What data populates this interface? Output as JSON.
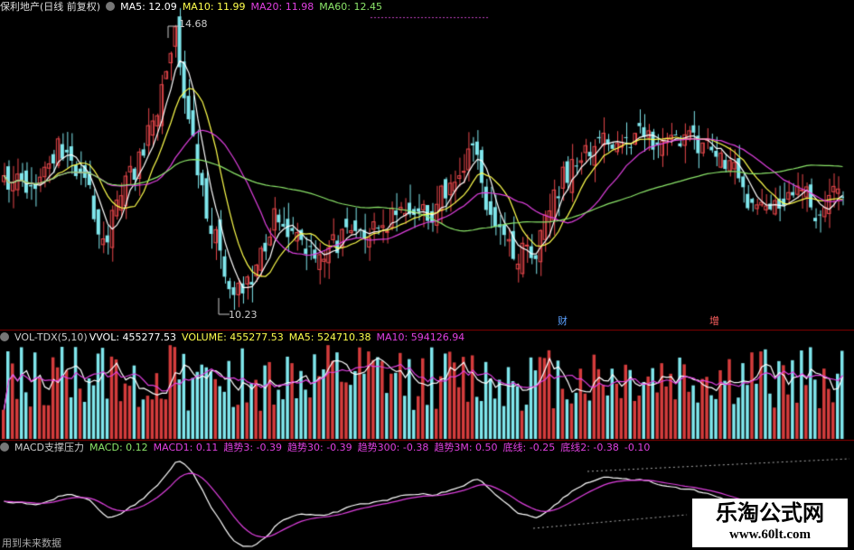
{
  "colors": {
    "up": "#e8474b",
    "up_vol": "#d43c3c",
    "down": "#7fe6ec",
    "white": "#ffffff",
    "yellow": "#ffff4d",
    "magenta": "#e040e0",
    "green": "#8ce66a",
    "label": "#cccccc",
    "grid": "#8b0000",
    "dots": "#c040c0"
  },
  "kline": {
    "stock_name": "保利地产(日线 前复权)",
    "ma5": "MA5: 12.09",
    "ma10": "MA10: 11.99",
    "ma20": "MA20: 11.98",
    "ma60": "MA60: 12.45",
    "high_label": "14.68",
    "low_label": "10.23",
    "markers": [
      "财",
      "增"
    ],
    "price_range": [
      9.8,
      14.9
    ]
  },
  "volume": {
    "indicator": "VOL-TDX(5,10)",
    "vvol": "VVOL: 455277.53",
    "volume": "VOLUME: 455277.53",
    "ma5": "MA5: 524710.38",
    "ma10": "MA10: 594126.94"
  },
  "macd": {
    "indicator": "MACD支撑压力",
    "macd": "MACD: 0.12",
    "macd1": "MACD1: 0.11",
    "trend3": "趋势3: -0.39",
    "trend30": "趋势30: -0.39",
    "trend300": "趋势300: -0.38",
    "trend3m": "趋势3M: 0.50",
    "bottom": "底线: -0.25",
    "bottom2": "底线2: -0.38",
    "extra": "-0.10"
  },
  "footer": {
    "future_data": "用到未来数据"
  },
  "watermark": {
    "title": "乐淘公式网",
    "url": "www.60lt.com"
  }
}
